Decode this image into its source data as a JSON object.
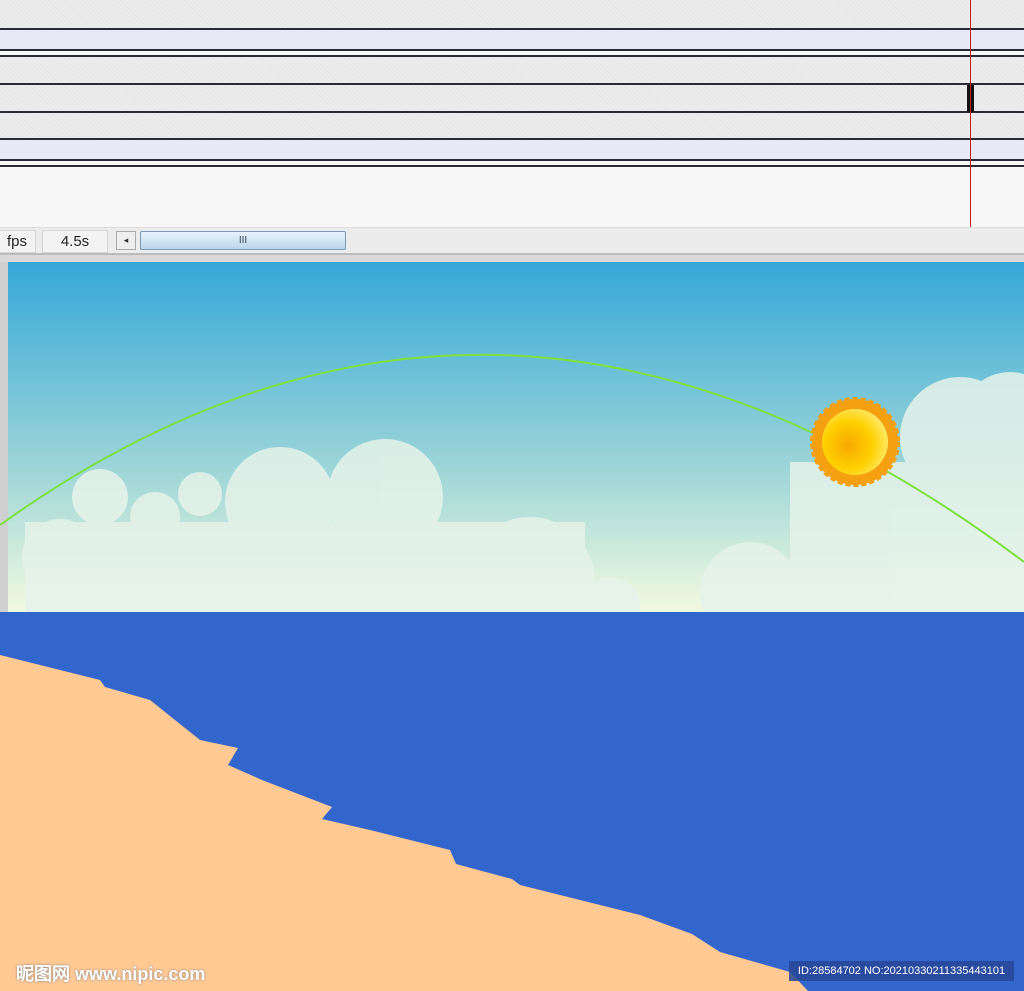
{
  "status": {
    "fps_label": "fps",
    "time": "4.5s",
    "scroll_left": "◂",
    "scroll_grip": "III"
  },
  "watermark": {
    "site": "昵图网 www.nipic.com",
    "id": "ID:28584702 NO:20210330211335443101"
  },
  "colors": {
    "sky_top": "#35a8d8",
    "sky_bottom": "#f2fae0",
    "sea": "#3366cc",
    "sand": "#ffc994",
    "sun": "#ffc800",
    "sun_rim": "#f5a010",
    "path": "#7ee040"
  }
}
